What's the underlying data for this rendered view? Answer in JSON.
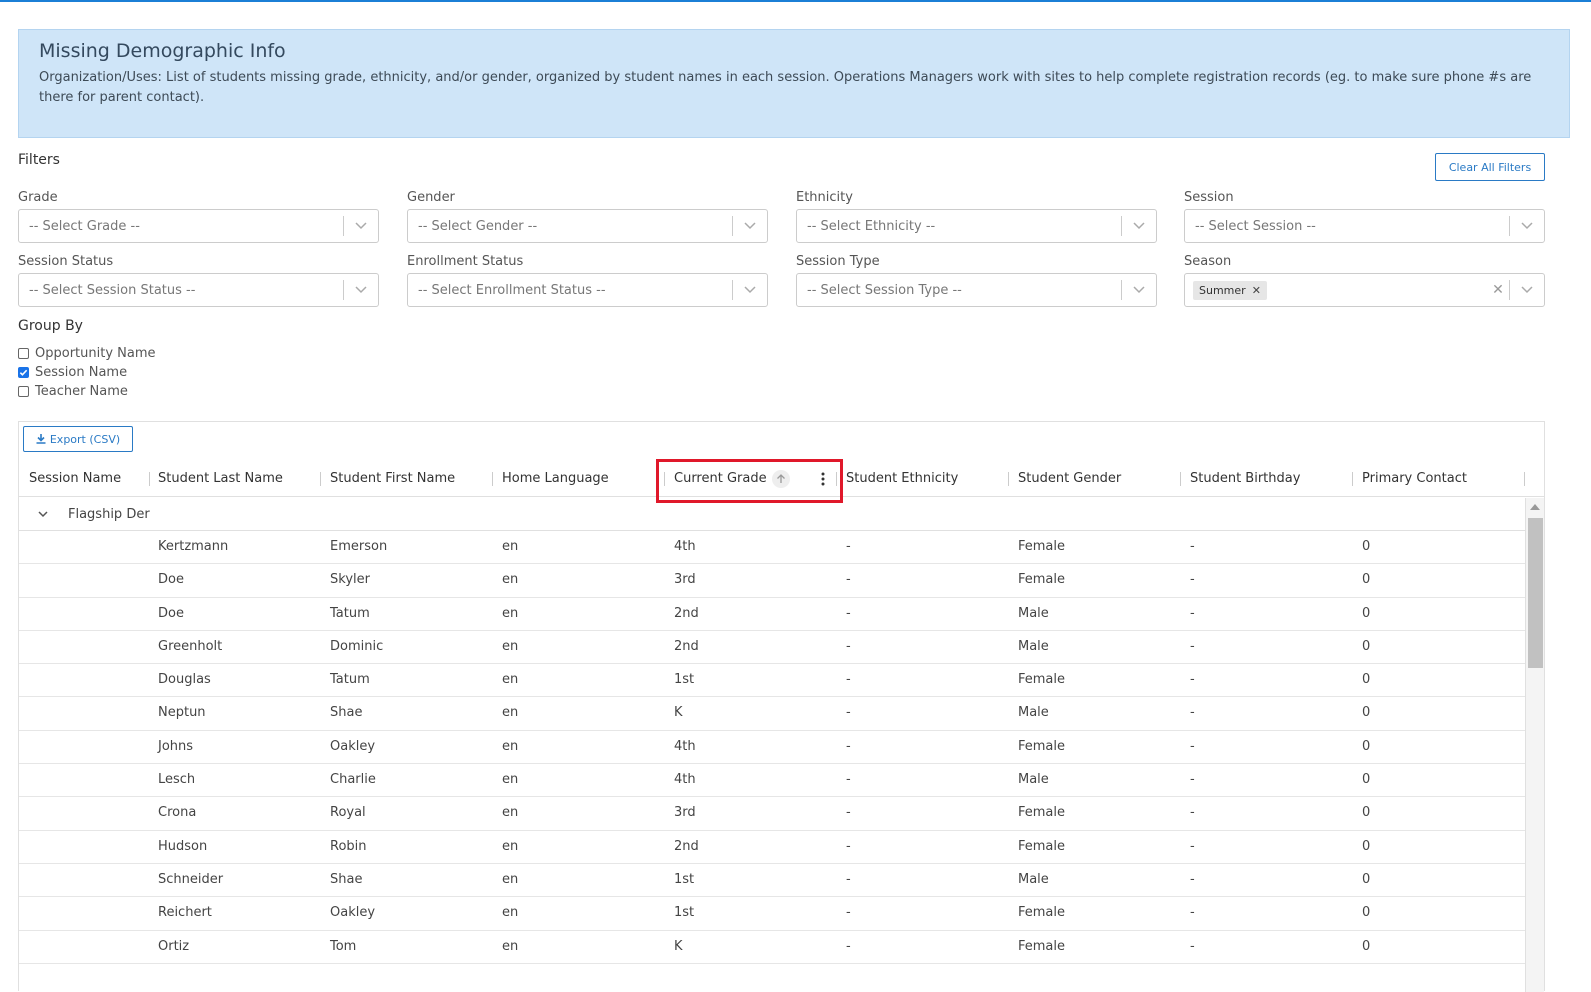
{
  "banner": {
    "title": "Missing Demographic Info",
    "description": "Organization/Uses: List of students missing grade, ethnicity, and/or gender, organized by student names in each session. Operations Managers work with sites to help complete registration records (eg. to make sure phone #s are there for parent contact)."
  },
  "filters": {
    "title": "Filters",
    "clear_label": "Clear All Filters",
    "grade": {
      "label": "Grade",
      "placeholder": "-- Select Grade --"
    },
    "gender": {
      "label": "Gender",
      "placeholder": "-- Select Gender --"
    },
    "ethnicity": {
      "label": "Ethnicity",
      "placeholder": "-- Select Ethnicity --"
    },
    "session": {
      "label": "Session",
      "placeholder": "-- Select Session --"
    },
    "session_status": {
      "label": "Session Status",
      "placeholder": "-- Select Session Status --"
    },
    "enrollment_status": {
      "label": "Enrollment Status",
      "placeholder": "-- Select Enrollment Status --"
    },
    "session_type": {
      "label": "Session Type",
      "placeholder": "-- Select Session Type --"
    },
    "season": {
      "label": "Season",
      "selected": "Summer"
    }
  },
  "group_by": {
    "title": "Group By",
    "options": [
      {
        "label": "Opportunity Name",
        "checked": false
      },
      {
        "label": "Session Name",
        "checked": true
      },
      {
        "label": "Teacher Name",
        "checked": false
      }
    ]
  },
  "grid": {
    "export_label": "Export (CSV)",
    "columns": [
      "Session Name",
      "Student Last Name",
      "Student First Name",
      "Home Language",
      "Current Grade",
      "Student Ethnicity",
      "Student Gender",
      "Student Birthday",
      "Primary Contact"
    ],
    "sorted_column": "Current Grade",
    "sort_direction": "ascending",
    "group_name": "Flagship Der",
    "rows": [
      [
        "Kertzmann",
        "Emerson",
        "en",
        "4th",
        "-",
        "Female",
        "-",
        "0"
      ],
      [
        "Doe",
        "Skyler",
        "en",
        "3rd",
        "-",
        "Female",
        "-",
        "0"
      ],
      [
        "Doe",
        "Tatum",
        "en",
        "2nd",
        "-",
        "Male",
        "-",
        "0"
      ],
      [
        "Greenholt",
        "Dominic",
        "en",
        "2nd",
        "-",
        "Male",
        "-",
        "0"
      ],
      [
        "Douglas",
        "Tatum",
        "en",
        "1st",
        "-",
        "Female",
        "-",
        "0"
      ],
      [
        "Neptun",
        "Shae",
        "en",
        "K",
        "-",
        "Male",
        "-",
        "0"
      ],
      [
        "Johns",
        "Oakley",
        "en",
        "4th",
        "-",
        "Female",
        "-",
        "0"
      ],
      [
        "Lesch",
        "Charlie",
        "en",
        "4th",
        "-",
        "Male",
        "-",
        "0"
      ],
      [
        "Crona",
        "Royal",
        "en",
        "3rd",
        "-",
        "Female",
        "-",
        "0"
      ],
      [
        "Hudson",
        "Robin",
        "en",
        "2nd",
        "-",
        "Female",
        "-",
        "0"
      ],
      [
        "Schneider",
        "Shae",
        "en",
        "1st",
        "-",
        "Male",
        "-",
        "0"
      ],
      [
        "Reichert",
        "Oakley",
        "en",
        "1st",
        "-",
        "Female",
        "-",
        "0"
      ],
      [
        "Ortiz",
        "Tom",
        "en",
        "K",
        "-",
        "Female",
        "-",
        "0"
      ]
    ]
  },
  "colors": {
    "accent": "#2a7ac5",
    "banner_bg": "#cfe5f8",
    "highlight": "#e0182a",
    "checkbox": "#1a73e8"
  },
  "icons": [
    "chevron-down-icon",
    "clear-x-icon",
    "download-icon",
    "sort-ascending-icon",
    "column-menu-icon",
    "group-collapse-icon",
    "checkmark-icon"
  ]
}
